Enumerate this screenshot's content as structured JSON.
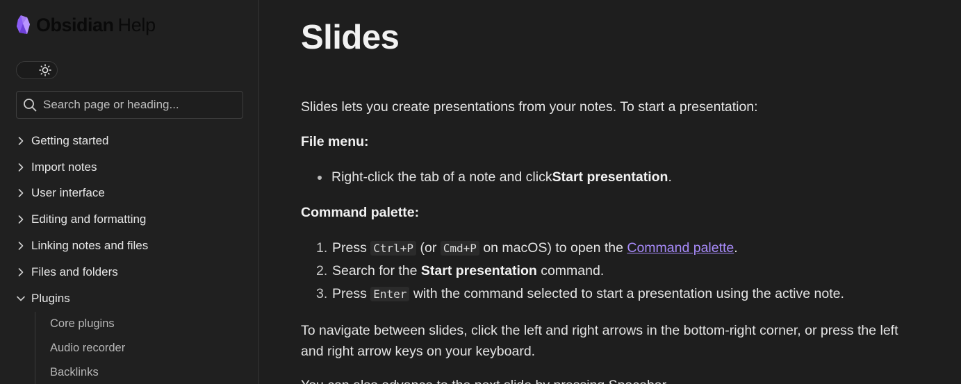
{
  "sidebar": {
    "logo_word": "Obsidian",
    "logo_suffix": "Help",
    "search_placeholder": "Search page or heading...",
    "nav_items": [
      {
        "label": "Getting started",
        "expanded": false
      },
      {
        "label": "Import notes",
        "expanded": false
      },
      {
        "label": "User interface",
        "expanded": false
      },
      {
        "label": "Editing and formatting",
        "expanded": false
      },
      {
        "label": "Linking notes and files",
        "expanded": false
      },
      {
        "label": "Files and folders",
        "expanded": false
      },
      {
        "label": "Plugins",
        "expanded": true
      }
    ],
    "sub_items": [
      "Core plugins",
      "Audio recorder",
      "Backlinks"
    ]
  },
  "page": {
    "title": "Slides",
    "intro": "Slides lets you create presentations from your notes. To start a presentation:",
    "file_menu_heading": "File menu:",
    "file_menu_bullet": {
      "pre": "Right-click the tab of a note and click ",
      "bold": "Start presentation",
      "post": "."
    },
    "command_palette_heading": "Command palette:",
    "steps": {
      "s1_num": "1.",
      "s1_pre": "Press ",
      "s1_code1": "Ctrl+P",
      "s1_mid": " (or ",
      "s1_code2": "Cmd+P",
      "s1_mid2": " on macOS) to open the ",
      "s1_link": "Command palette",
      "s1_post": ".",
      "s2_num": "2.",
      "s2_pre": "Search for the ",
      "s2_bold": "Start presentation",
      "s2_post": " command.",
      "s3_num": "3.",
      "s3_pre": "Press ",
      "s3_code": "Enter",
      "s3_post": " with the command selected to start a presentation using the active note."
    },
    "navigate_para": "To navigate between slides, click the left and right arrows in the bottom-right corner, or press the left and right arrow keys on your keyboard.",
    "advance_para": "You can also advance to the next slide by pressing Spacebar."
  },
  "colors": {
    "background": "#1e1e1e",
    "sidebar": "#202020",
    "link": "#a88bfa",
    "logo_accent": "#a47cf3"
  },
  "icons": [
    "obsidian-logo-icon",
    "sun-icon",
    "search-icon",
    "chevron-right-icon",
    "chevron-down-icon"
  ]
}
